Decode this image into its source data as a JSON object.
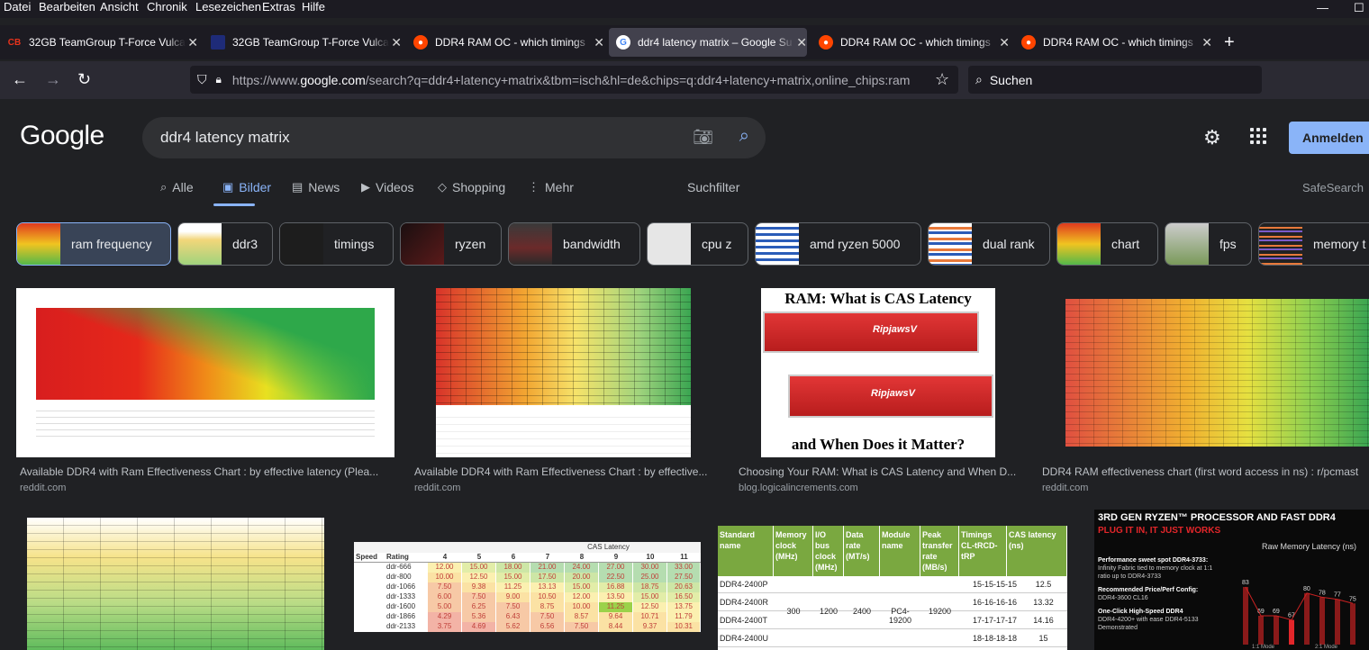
{
  "menu": [
    "Datei",
    "Bearbeiten",
    "Ansicht",
    "Chronik",
    "Lesezeichen",
    "Extras",
    "Hilfe"
  ],
  "window_controls": {
    "minimize": "—",
    "maximize": "☐"
  },
  "tabs": [
    {
      "title": "32GB TeamGroup T-Force Vulcan",
      "favicon": "cb-icon",
      "fav_color": "#e8331c"
    },
    {
      "title": "32GB TeamGroup T-Force Vulcan",
      "favicon": "navy-icon",
      "fav_color": "#1e2b78"
    },
    {
      "title": "DDR4 RAM OC - which timings",
      "favicon": "reddit-icon",
      "fav_color": "#ff4500"
    },
    {
      "title": "ddr4 latency matrix – Google Su",
      "favicon": "google-icon",
      "fav_color": "#ffffff"
    },
    {
      "title": "DDR4 RAM OC - which timings",
      "favicon": "reddit-icon",
      "fav_color": "#ff4500"
    },
    {
      "title": "DDR4 RAM OC - which timings",
      "favicon": "reddit-icon",
      "fav_color": "#ff4500"
    }
  ],
  "url": {
    "prefix": "https://www.",
    "host": "google.com",
    "path": "/search?q=ddr4+latency+matrix&tbm=isch&hl=de&chips=q:ddr4+latency+matrix,online_chips:ram"
  },
  "browser_search_placeholder": "Suchen",
  "google": {
    "logo": "Google",
    "query": "ddr4 latency matrix",
    "signin": "Anmelden",
    "tabs": [
      "Alle",
      "Bilder",
      "News",
      "Videos",
      "Shopping",
      "Mehr"
    ],
    "filter": "Suchfilter",
    "safesearch": "SafeSearch"
  },
  "chips": [
    "ram frequency",
    "ddr3",
    "timings",
    "ryzen",
    "bandwidth",
    "cpu z",
    "amd ryzen 5000",
    "dual rank",
    "chart",
    "fps",
    "memory t"
  ],
  "results": [
    {
      "caption": "Available DDR4 with Ram Effectiveness Chart : by effective latency (Plea...",
      "source": "reddit.com"
    },
    {
      "caption": "Available DDR4 with Ram Effectiveness Chart : by effective...",
      "source": "reddit.com"
    },
    {
      "caption": "Choosing Your RAM: What is CAS Latency and When D...",
      "source": "blog.logicalincrements.com",
      "image_title": "RAM: What is CAS Latency",
      "image_bottom": "and When Does it Matter?",
      "brand": "RipjawsV"
    },
    {
      "caption": "DDR4 RAM effectiveness chart (first word access in ns) : r/pcmast",
      "source": "reddit.com"
    }
  ],
  "row2": {
    "cas_table": {
      "title": "CAS Latency",
      "headers": [
        "Speed",
        "Rating",
        "4",
        "5",
        "6",
        "7",
        "8",
        "9",
        "10",
        "11"
      ],
      "ratings": [
        "ddr-666",
        "ddr-800",
        "ddr-1066",
        "ddr-1333",
        "ddr-1600",
        "ddr-1866",
        "ddr-2133"
      ],
      "rows": [
        [
          "12.00",
          "15.00",
          "18.00",
          "21.00",
          "24.00",
          "27.00",
          "30.00",
          "33.00"
        ],
        [
          "10.00",
          "12.50",
          "15.00",
          "17.50",
          "20.00",
          "22.50",
          "25.00",
          "27.50"
        ],
        [
          "7.50",
          "9.38",
          "11.25",
          "13.13",
          "15.00",
          "16.88",
          "18.75",
          "20.63"
        ],
        [
          "6.00",
          "7.50",
          "9.00",
          "10.50",
          "12.00",
          "13.50",
          "15.00",
          "16.50"
        ],
        [
          "5.00",
          "6.25",
          "7.50",
          "8.75",
          "10.00",
          "11.25",
          "12.50",
          "13.75"
        ],
        [
          "4.29",
          "5.36",
          "6.43",
          "7.50",
          "8.57",
          "9.64",
          "10.71",
          "11.79"
        ],
        [
          "3.75",
          "4.69",
          "5.62",
          "6.56",
          "7.50",
          "8.44",
          "9.37",
          "10.31"
        ]
      ]
    },
    "spec_table": {
      "headers": [
        "Standard name",
        "Memory clock (MHz)",
        "I/O bus clock (MHz)",
        "Data rate (MT/s)",
        "Module name",
        "Peak transfer rate (MB/s)",
        "Timings CL-tRCD-tRP",
        "CAS latency (ns)"
      ],
      "names": [
        "DDR4-2400P",
        "DDR4-2400R",
        "DDR4-2400T",
        "DDR4-2400U"
      ],
      "memory_clock": "300",
      "io_clock": "1200",
      "data_rate": "2400",
      "module": "PC4-19200",
      "peak": "19200",
      "timings": [
        "15-15-15-15",
        "16-16-16-16",
        "17-17-17-17",
        "18-18-18-18"
      ],
      "cas": [
        "12.5",
        "13.32",
        "14.16",
        "15"
      ]
    },
    "ryzen": {
      "title": "3RD GEN RYZEN™ PROCESSOR AND FAST DDR4",
      "subtitle": "PLUG IT IN, IT JUST WORKS",
      "chart_title": "Raw Memory Latency (ns)",
      "bullets": [
        {
          "head": "Performance sweet spot DDR4-3733:",
          "body": "Infinity Fabric tied to memory clock at 1:1 ratio up to DDR4-3733"
        },
        {
          "head": "Recommended Price/Perf Config:",
          "body": "DDR4-3600 CL16"
        },
        {
          "head": "One-Click High-Speed DDR4",
          "body": "DDR4-4200+ with ease DDR4-5133 Demonstrated"
        }
      ],
      "values": [
        "83",
        "69",
        "69",
        "67",
        "80",
        "78",
        "77",
        "75"
      ],
      "mode_labels": [
        "1:1 Mode",
        "2:1 Mode"
      ]
    }
  }
}
